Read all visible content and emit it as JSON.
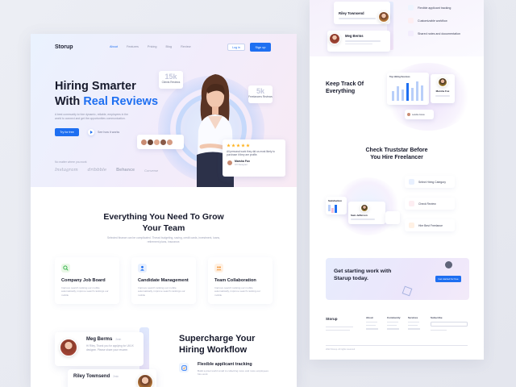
{
  "left": {
    "nav": {
      "logo": "Storup",
      "links": [
        "About",
        "Features",
        "Pricing",
        "Blog",
        "Review"
      ],
      "active_index": 0,
      "login": "Log in",
      "signup": "Sign up"
    },
    "hero": {
      "title_line1": "Hiring Smarter",
      "title_line2_prefix": "With ",
      "title_line2_accent": "Real Reviews",
      "description": "A best community to hire dynamic, reliable, employees in the world to connect and get the opportunities communication.",
      "try_button": "Try for free",
      "see_how": "See how it works",
      "no_matter": "No matter where you work",
      "brands": [
        "Instagram",
        "dribbble",
        "Behance",
        "Converse"
      ],
      "stat1": {
        "number": "15k",
        "label": "Clients Reviews"
      },
      "stat2": {
        "number": "5k",
        "label": "Freelancers Reviews"
      },
      "review": {
        "text": "All personal work they did us most likely to purchase it they are profile.",
        "author": "Marsha Fox",
        "role": "UX Designer"
      }
    },
    "features": {
      "title_line1": "Everything You Need To Grow",
      "title_line2": "Your Team",
      "subtitle": "Selected finance can be complicated. Thread budgeting, saving, credit cards, investment, loans, retirement plans, insurance.",
      "cards": [
        {
          "title": "Company Job Board",
          "desc": "Improve search ranking our mobile automatically, improve search rankings our mobile"
        },
        {
          "title": "Candidate Management",
          "desc": "Improve search ranking our mobile automatically, improve search rankings our mobile"
        },
        {
          "title": "Team Collaboration",
          "desc": "Improve search ranking our mobile automatically, improve search ranking our mobile"
        }
      ]
    },
    "workflow": {
      "messages": [
        {
          "name": "Meg Berms",
          "time": "2min",
          "text": "Hi Riley, Thank you for applying for UI/UX designer. Please share your resume."
        },
        {
          "name": "Riley Townsend",
          "time": "2min",
          "text": ""
        }
      ],
      "title_line1": "Supercharge Your",
      "title_line2": "Hiring Workflow",
      "item_title": "Flexible applicant tracking",
      "item_desc": "Build a pixel world small to collecting more and more employees hire work"
    }
  },
  "right": {
    "top_cards": [
      {
        "name": "Riley Townsend"
      },
      {
        "name": "Meg Berms"
      }
    ],
    "top_list": [
      "Flexible applicant tracking",
      "Customizable workflow",
      "Shared notes and documentation"
    ],
    "track": {
      "title_line1": "Keep Track Of",
      "title_line2": "Everything",
      "chart_label": "Top Hiring Sources",
      "person_name": "Marsha Fox",
      "person2": "Landra Jones"
    },
    "trust": {
      "title_line1": "Check Truststar Before",
      "title_line2": "You Hire Freelancer",
      "satisfaction": "Satisfaction",
      "person": "Sam Jefferson",
      "steps": [
        "Select Hiring Category",
        "Check Review",
        "Hire Best Freelance"
      ]
    },
    "cta": {
      "title_line1": "Get starting work with",
      "title_line2": "Starup today.",
      "button": "Get started for free"
    },
    "footer": {
      "logo": "Storup",
      "columns": [
        "About",
        "Community",
        "Services",
        "Subscribe"
      ],
      "copyright": "2022 Storup. All rights reserved"
    }
  },
  "colors": {
    "accent": "#1e6ff1",
    "heading": "#16192b",
    "muted": "#9ea2b8",
    "star": "#ffb21d",
    "background": "#e8eaf1"
  }
}
